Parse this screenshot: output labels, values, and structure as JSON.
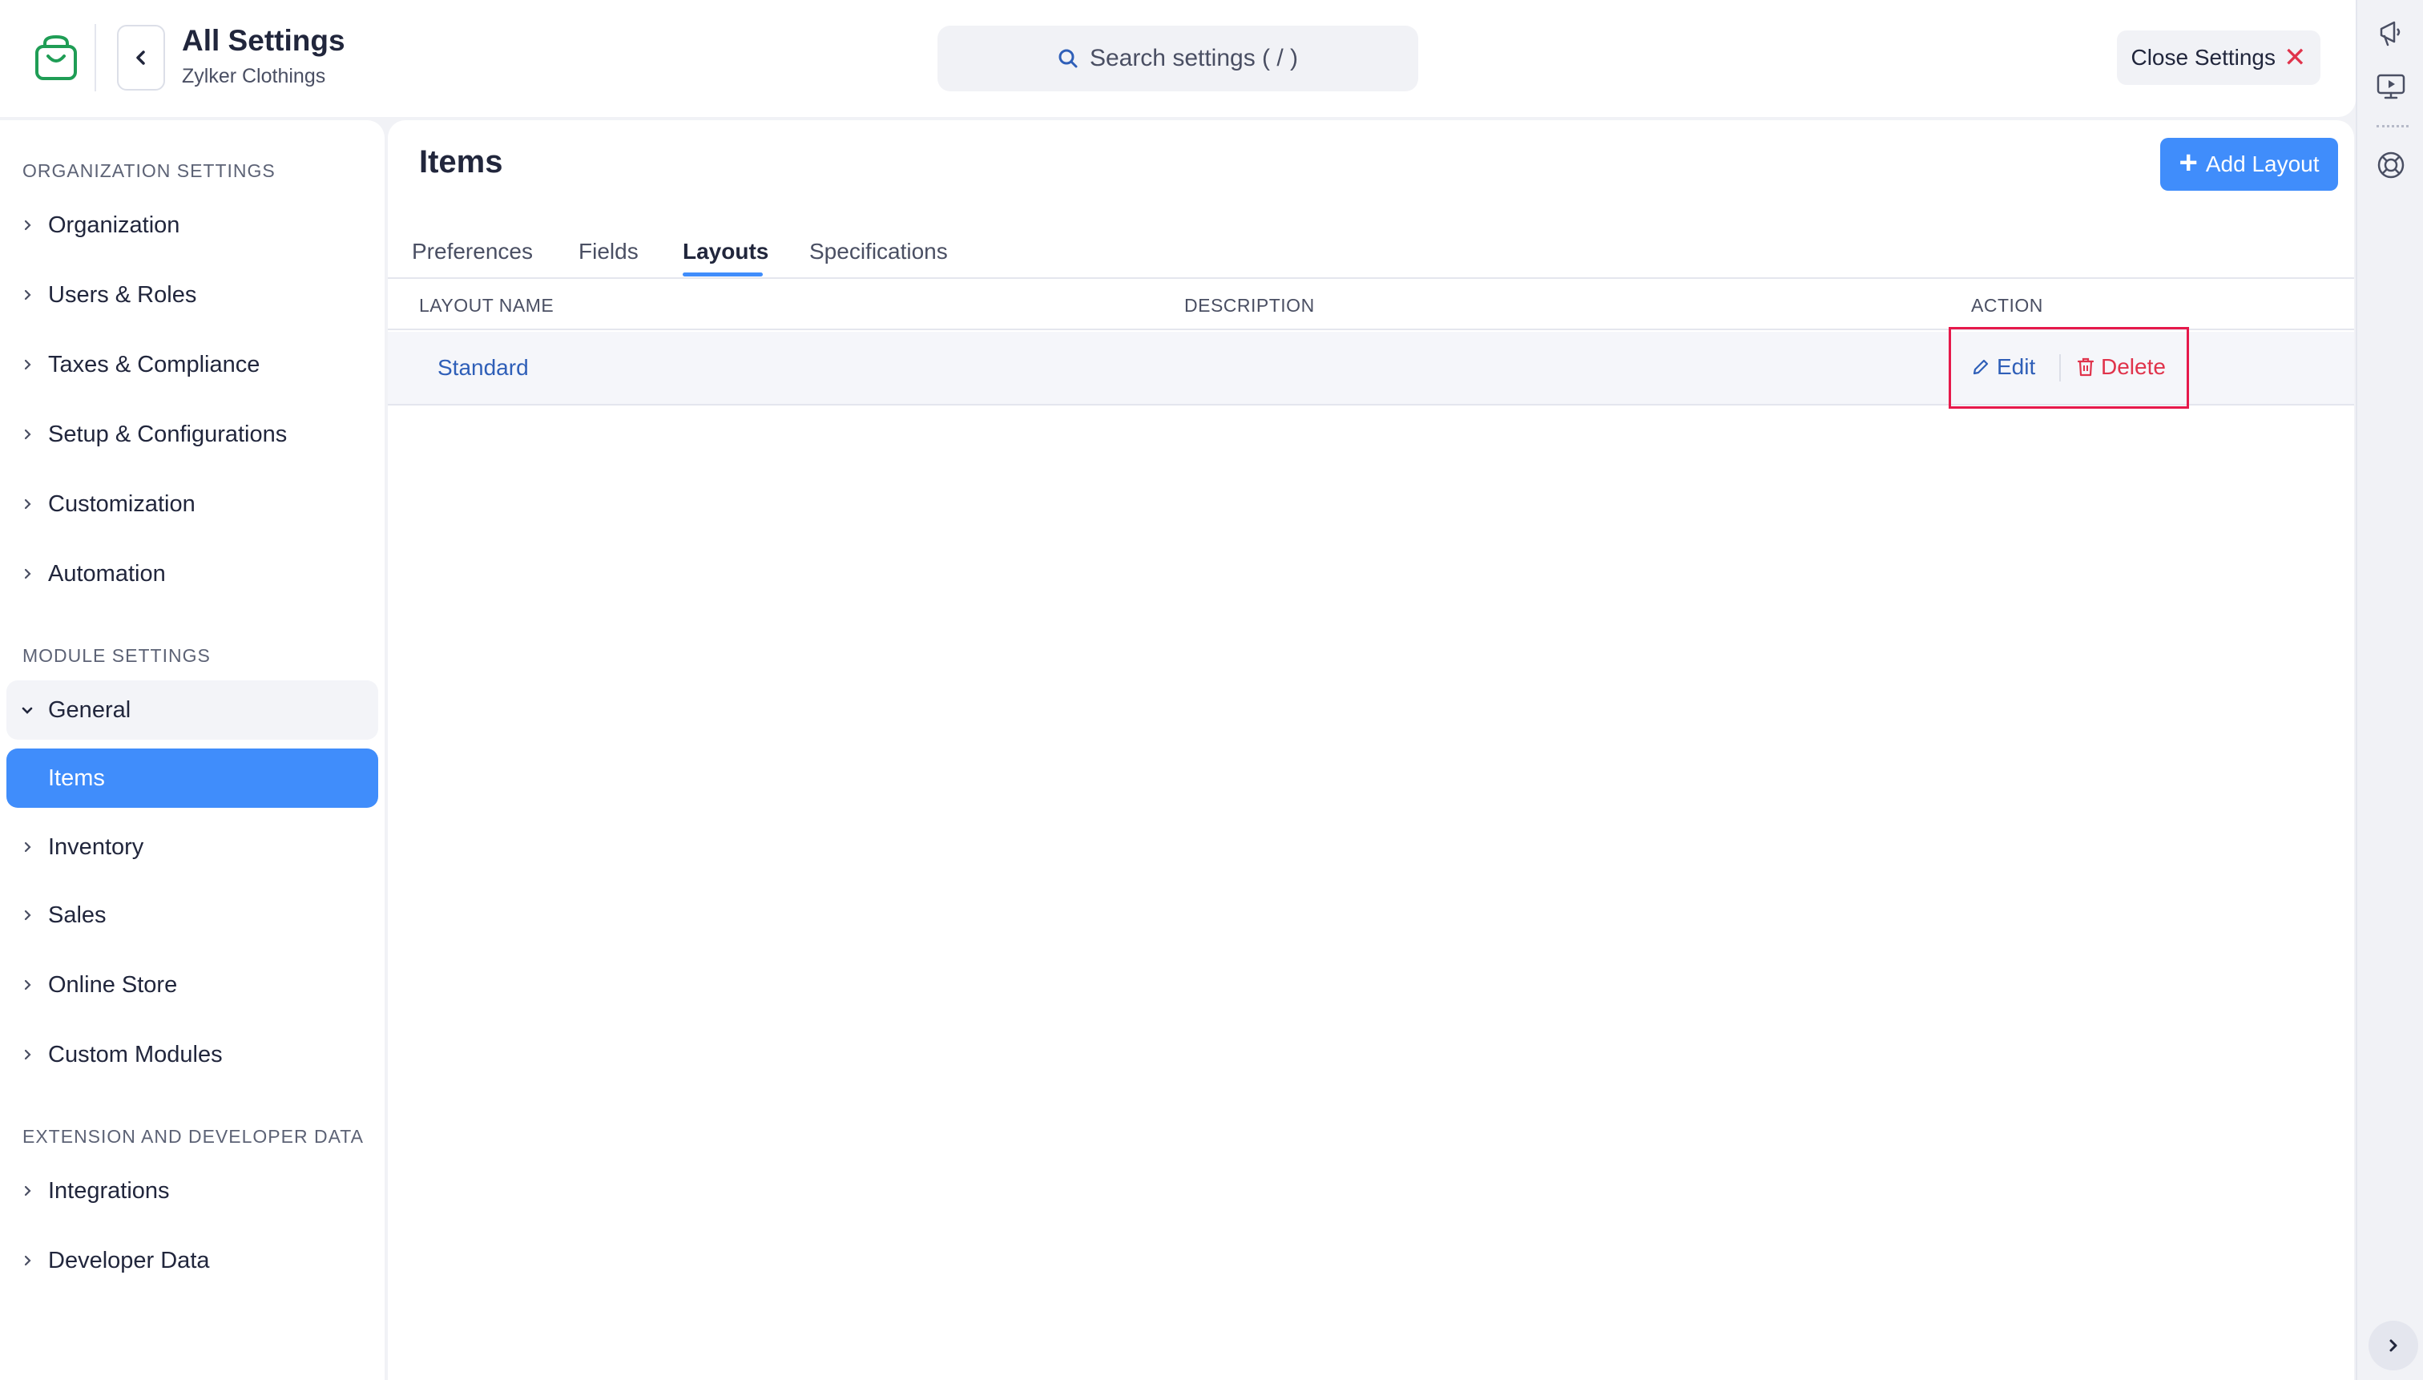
{
  "header": {
    "title": "All Settings",
    "subtitle": "Zylker Clothings",
    "search_placeholder": "Search settings ( / )",
    "close_label": "Close Settings",
    "back_icon": "chevron-left-icon",
    "logo_icon": "shopping-bag-icon"
  },
  "sidebar": {
    "org_heading": "ORGANIZATION SETTINGS",
    "org_items": [
      {
        "label": "Organization"
      },
      {
        "label": "Users & Roles"
      },
      {
        "label": "Taxes & Compliance"
      },
      {
        "label": "Setup & Configurations"
      },
      {
        "label": "Customization"
      },
      {
        "label": "Automation"
      }
    ],
    "module_heading": "MODULE SETTINGS",
    "module_items": [
      {
        "label": "General",
        "expanded": true
      },
      {
        "label": "Items",
        "active": true
      },
      {
        "label": "Inventory"
      },
      {
        "label": "Sales"
      },
      {
        "label": "Online Store"
      },
      {
        "label": "Custom Modules"
      }
    ],
    "ext_heading": "EXTENSION AND DEVELOPER DATA",
    "ext_items": [
      {
        "label": "Integrations"
      },
      {
        "label": "Developer Data"
      }
    ]
  },
  "main": {
    "title": "Items",
    "add_button_label": "Add Layout",
    "tabs": [
      {
        "label": "Preferences"
      },
      {
        "label": "Fields"
      },
      {
        "label": "Layouts",
        "active": true
      },
      {
        "label": "Specifications"
      }
    ],
    "table": {
      "columns": [
        "LAYOUT NAME",
        "DESCRIPTION",
        "ACTION"
      ],
      "rows": [
        {
          "name": "Standard",
          "description": "",
          "actions": [
            "Edit",
            "Delete"
          ]
        }
      ]
    }
  },
  "rail": {
    "icons": [
      "megaphone-icon",
      "video-tutorial-icon",
      "help-lifebuoy-icon",
      "expand-chevron-icon"
    ]
  },
  "colors": {
    "accent": "#408dfb",
    "danger": "#e0334b",
    "link": "#2f5fb8",
    "highlight_box": "#e6194b",
    "logo_green": "#1f9d55"
  }
}
